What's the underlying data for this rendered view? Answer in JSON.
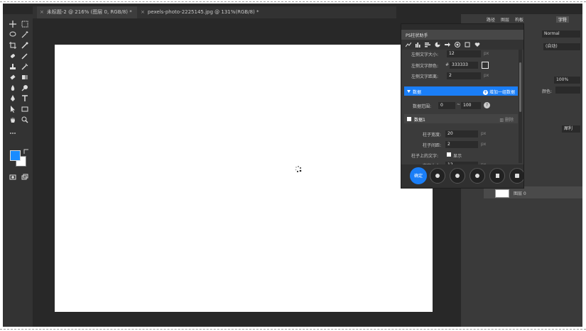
{
  "tabs": [
    {
      "label": "未标题-2 @ 216% (图层 0, RGB/8) *",
      "active": true
    },
    {
      "label": "pexels-photo-2225145.jpg @ 131%(RGB/8) *",
      "active": false
    }
  ],
  "right_panel": {
    "tabs": [
      "路径",
      "图层",
      "构板",
      "字符"
    ],
    "selected_tab": "字符",
    "blend_mode": "Normal",
    "leading": "(自动)",
    "scale_value": "100%",
    "color_label": "颜色:",
    "layer_name": "图层 0",
    "sharp_label": "犀利"
  },
  "plugin": {
    "title": "PS柱状助手",
    "rows": [
      {
        "label": "左侧文字大小:",
        "value": "12",
        "unit": "px"
      },
      {
        "label": "左侧文字颜色:",
        "hash": "#",
        "value": "333333"
      },
      {
        "label": "左侧文字距离:",
        "value": "2",
        "unit": "px"
      }
    ],
    "data_section": {
      "label": "数据",
      "add_label": "增加一组数据",
      "range_label": "数据范围:",
      "range_min": "0",
      "range_sep": "~",
      "range_max": "100",
      "help": "?"
    },
    "data1": {
      "label": "数据1",
      "delete_label": "删除",
      "rows": [
        {
          "label": "柱子宽度:",
          "value": "20",
          "unit": "px"
        },
        {
          "label": "柱子间距:",
          "value": "2",
          "unit": "px"
        }
      ],
      "show_text_label": "柱子上的文字:",
      "show_text_option": "显示",
      "font_size_label": "文字大小:",
      "font_size_value": "12",
      "font_size_unit": "px"
    },
    "generate_label": "确定"
  }
}
